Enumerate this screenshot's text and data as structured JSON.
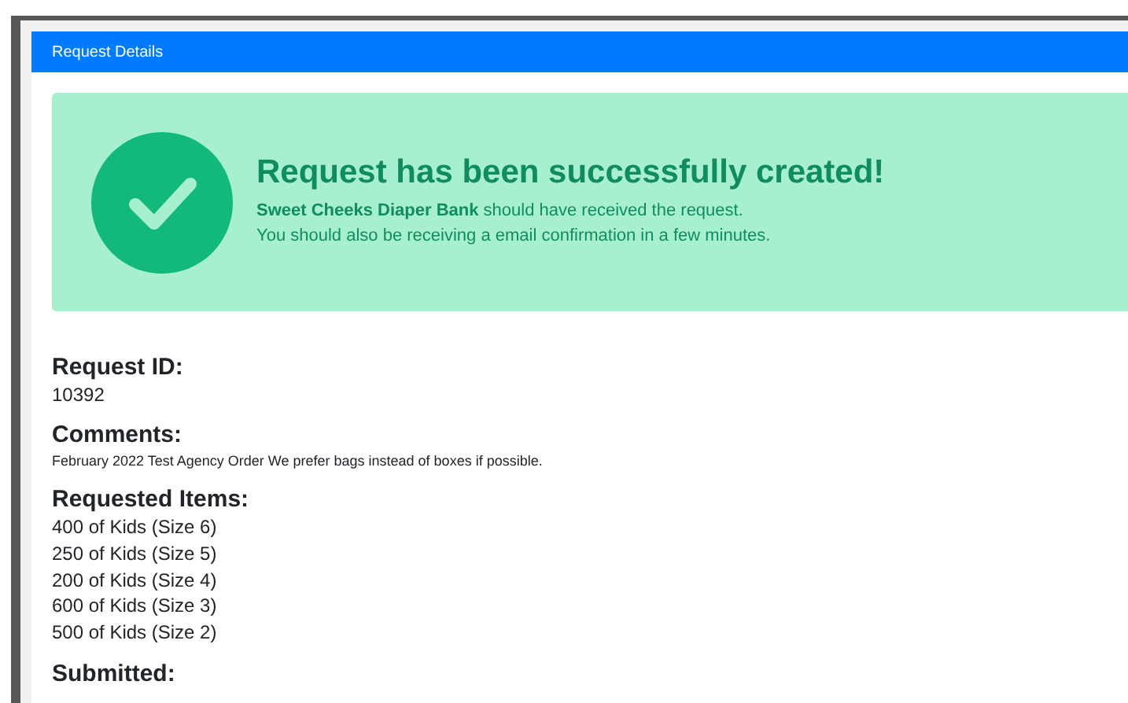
{
  "card": {
    "title": "Request Details"
  },
  "alert": {
    "title": "Request has been successfully created!",
    "message": "**Sweet Cheeks Diaper Bank** should have received the request.",
    "note": "You should also be receiving a email confirmation in a few minutes."
  },
  "details": [
    {
      "label": "Request ID:",
      "kind": "value",
      "value": "10392"
    },
    {
      "label": "Comments:",
      "kind": "small",
      "value": "February 2022 Test Agency Order We prefer bags instead of boxes if possible."
    },
    {
      "label": "Requested Items:",
      "kind": "list",
      "items": [
        "400 of Kids (Size 6)",
        "250 of Kids (Size 5)",
        "200 of Kids (Size 4)",
        "600 of Kids (Size 3)",
        "500 of Kids (Size 2)"
      ]
    },
    {
      "label": "Submitted:",
      "kind": "label"
    }
  ]
}
